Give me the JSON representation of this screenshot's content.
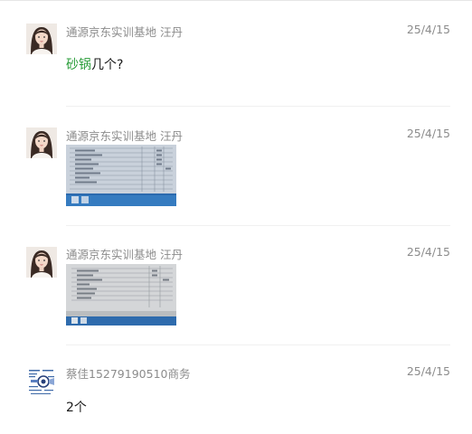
{
  "messages": [
    {
      "sender": "通源京东实训基地 汪丹",
      "date": "25/4/15",
      "highlight": "砂锅",
      "text": "几个?"
    },
    {
      "sender": "通源京东实训基地 汪丹",
      "date": "25/4/15",
      "image_desc": "photo-screen"
    },
    {
      "sender": "通源京东实训基地 汪丹",
      "date": "25/4/15",
      "image_desc": "photo-screen"
    },
    {
      "sender": "蔡佳15279190510商务",
      "date": "25/4/15",
      "text": "2个"
    }
  ]
}
